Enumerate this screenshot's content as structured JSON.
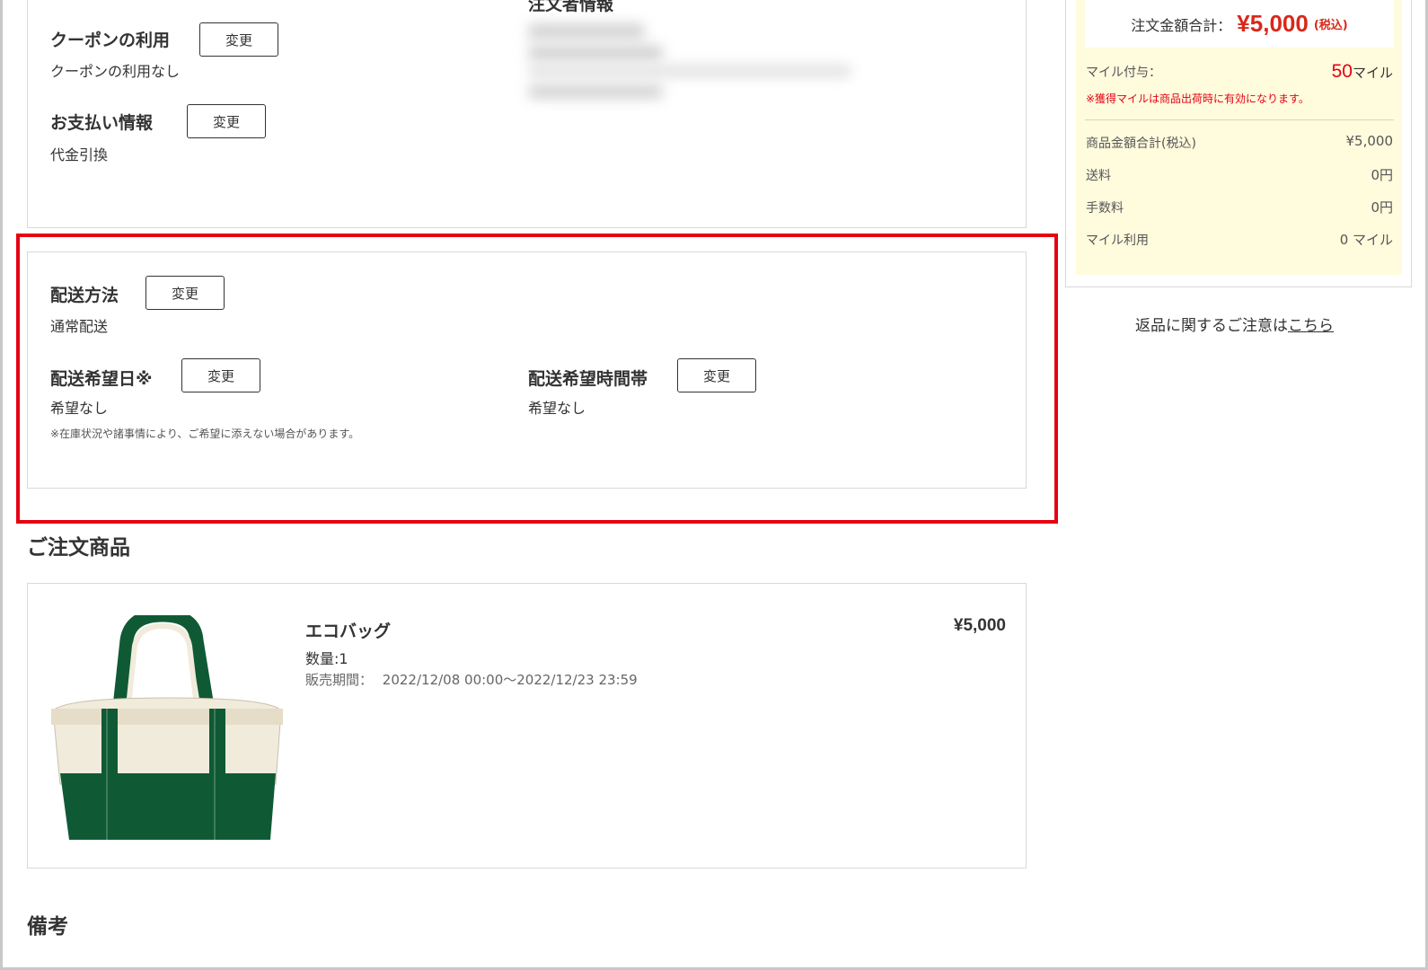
{
  "top_panel": {
    "coupon": {
      "label": "クーポンの利用",
      "button": "変更",
      "value": "クーポンの利用なし"
    },
    "payment": {
      "label": "お支払い情報",
      "button": "変更",
      "value": "代金引換"
    },
    "orderer": {
      "label": "注文者情報"
    }
  },
  "delivery_panel": {
    "method": {
      "label": "配送方法",
      "button": "変更",
      "value": "通常配送"
    },
    "date": {
      "label": "配送希望日※",
      "button": "変更",
      "value": "希望なし",
      "note": "※在庫状況や諸事情により、ご希望に添えない場合があります。"
    },
    "time": {
      "label": "配送希望時間帯",
      "button": "変更",
      "value": "希望なし"
    }
  },
  "products_section": {
    "title": "ご注文商品",
    "items": [
      {
        "name": "エコバッグ",
        "quantity": "数量:1",
        "sale_period_label": "販売期間：",
        "sale_period": "2022/12/08 00:00〜2022/12/23 23:59",
        "price": "¥5,000"
      }
    ]
  },
  "remarks_section": {
    "title": "備考"
  },
  "summary": {
    "total_label": "注文金額合計：",
    "total_value": "¥5,000",
    "total_tax": "(税込)",
    "miles_label": "マイル付与：",
    "miles_value": "50",
    "miles_unit": "マイル",
    "miles_note": "※獲得マイルは商品出荷時に有効になります。",
    "rows": [
      {
        "label": "商品金額合計(税込)",
        "value": "¥5,000"
      },
      {
        "label": "送料",
        "value": "0円"
      },
      {
        "label": "手数料",
        "value": "0円"
      },
      {
        "label": "マイル利用",
        "value": "0 マイル"
      }
    ]
  },
  "return_note": {
    "text": "返品に関するご注意は",
    "link": "こちら"
  },
  "colors": {
    "accent_red": "#e60012",
    "price_red": "#d9281a",
    "summary_bg": "#fffbdd",
    "bag_green": "#0f5a34",
    "bag_canvas": "#f1ebdc"
  }
}
